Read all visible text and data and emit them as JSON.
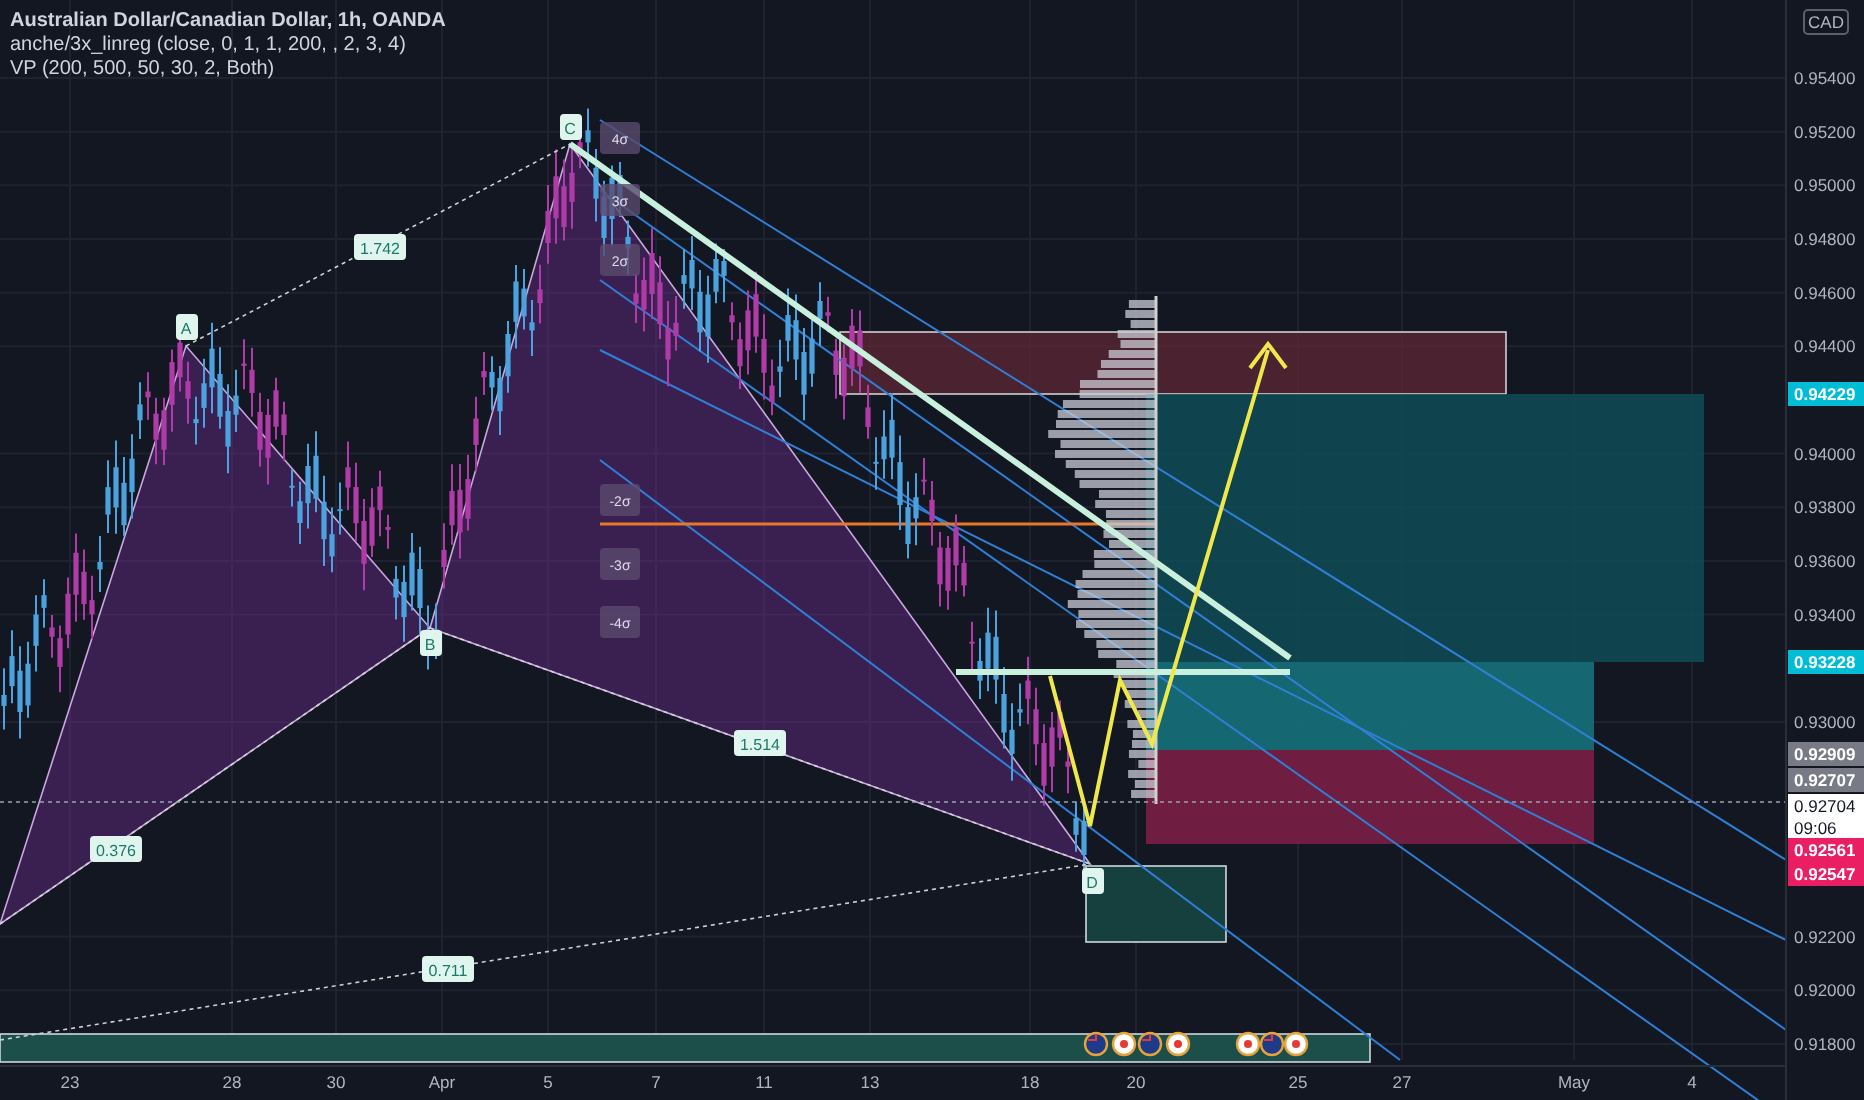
{
  "header": {
    "title": "Australian Dollar/Canadian Dollar, 1h, OANDA",
    "indicators": [
      "anche/3x_linreg (close, 0, 1, 1, 200, , 2, 3, 4)",
      "VP (200, 500, 50, 30, 2, Both)"
    ]
  },
  "pattern": {
    "points": [
      {
        "label": "A"
      },
      {
        "label": "B"
      },
      {
        "label": "C"
      },
      {
        "label": "D"
      }
    ],
    "ratios": [
      "1.742",
      "1.514",
      "0.376",
      "0.711"
    ]
  },
  "sigma_labels": [
    "4σ",
    "3σ",
    "2σ",
    "-2σ",
    "-3σ",
    "-4σ"
  ],
  "price_axis": {
    "currency": "CAD",
    "ticks": [
      "0.95400",
      "0.95200",
      "0.95000",
      "0.94800",
      "0.94600",
      "0.94400",
      "0.94000",
      "0.93800",
      "0.93600",
      "0.93400",
      "0.93000",
      "0.92200",
      "0.92000",
      "0.91800"
    ],
    "markers": [
      {
        "label": "0.94229",
        "color": "#00bcd4"
      },
      {
        "label": "0.93228",
        "color": "#00bcd4"
      },
      {
        "label": "0.92909",
        "color": "#787b86"
      },
      {
        "label": "0.92707",
        "color": "#787b86"
      },
      {
        "label": "0.92704",
        "time": "09:06",
        "color": "#ffffff"
      },
      {
        "label": "0.92561",
        "color": "#e91e63"
      },
      {
        "label": "0.92547",
        "color": "#e91e63"
      }
    ]
  },
  "time_axis": [
    "23",
    "28",
    "30",
    "Apr",
    "5",
    "7",
    "11",
    "13",
    "18",
    "20",
    "25",
    "27",
    "May",
    "4"
  ],
  "events": [
    {
      "kind": "au"
    },
    {
      "kind": "ca"
    },
    {
      "kind": "au"
    },
    {
      "kind": "ca"
    },
    {
      "kind": "ca"
    },
    {
      "kind": "au"
    },
    {
      "kind": "ca"
    }
  ]
}
